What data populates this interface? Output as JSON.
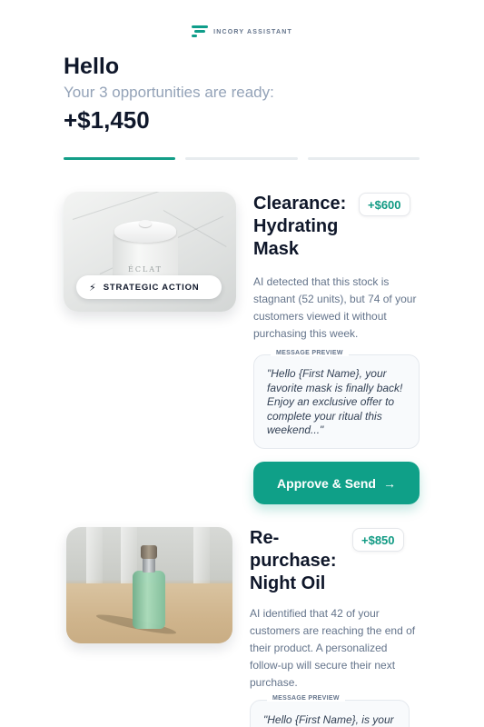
{
  "brand": {
    "name": "INCORY ASSISTANT",
    "logo_icon": "incory-logo-icon",
    "accent": "#0f9d8a"
  },
  "greeting": {
    "hello": "Hello",
    "subtitle": "Your 3 opportunities are ready:",
    "total": "+$1,450"
  },
  "progress": {
    "steps": 3,
    "active_step": 1
  },
  "cards": [
    {
      "title": "Clearance: Hydrating Mask",
      "amount": "+$600",
      "image_label": "ÉCLAT",
      "tag": "STRATEGIC ACTION",
      "tag_icon": "lightning-icon",
      "description": "AI detected that this stock is stagnant (52 units), but 74 of your customers viewed it without purchasing this week.",
      "preview_label": "MESSAGE PREVIEW",
      "preview_text": "\"Hello {First Name}, your favorite mask is finally back! Enjoy an exclusive offer to complete your ritual this weekend...\"",
      "button_label": "Approve & Send",
      "button_icon": "arrow-right-icon"
    },
    {
      "title": "Re-purchase: Night Oil",
      "amount": "+$850",
      "description": "AI identified that 42 of your customers are reaching the end of their product. A personalized follow-up will secure their next purchase.",
      "preview_label": "MESSAGE PREVIEW",
      "preview_text": "\"Hello {First Name}, is your"
    }
  ]
}
